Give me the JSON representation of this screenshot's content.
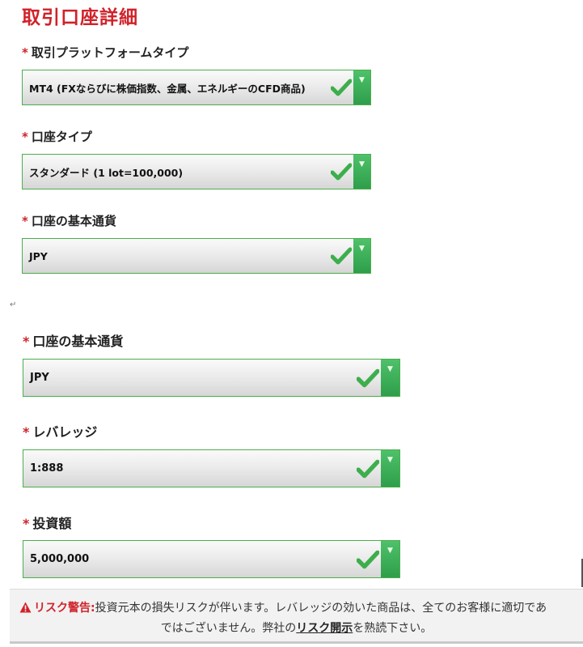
{
  "page": {
    "title": "取引口座詳細"
  },
  "required_mark": "*",
  "fields_set1": [
    {
      "label": "取引プラットフォームタイプ",
      "value": "MT4 (FXならびに株価指数、金属、エネルギーのCFD商品)"
    },
    {
      "label": "口座タイプ",
      "value": "スタンダード (1 lot=100,000)"
    },
    {
      "label": "口座の基本通貨",
      "value": "JPY"
    }
  ],
  "return_mark": "↵",
  "fields_set2": [
    {
      "label": "口座の基本通貨",
      "value": "JPY"
    },
    {
      "label": "レバレッジ",
      "value": "1:888"
    },
    {
      "label": "投資額",
      "value": "5,000,000"
    }
  ],
  "risk": {
    "title": "リスク警告",
    "colon": ":",
    "text_line1": "投資元本の損失リスクが伴います。レバレッジの効いた商品は、全てのお客様に適切であ",
    "text_line2_pre": "ではございません。弊社の",
    "link_label": "リスク開示",
    "text_line2_post": "を熟読下さい。"
  },
  "colors": {
    "accent_red": "#d0222a",
    "valid_green": "#3cae4c"
  },
  "icons": {
    "check": "check-icon",
    "dropdown": "triangle-down-icon",
    "warning": "warning-triangle-icon"
  }
}
